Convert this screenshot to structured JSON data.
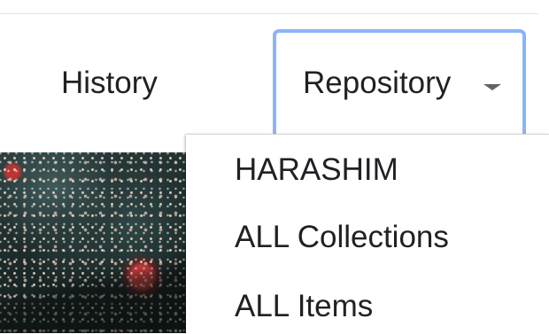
{
  "nav": {
    "history_label": "History",
    "repository_label": "Repository"
  },
  "dropdown": {
    "items": [
      {
        "label": "HARASHIM"
      },
      {
        "label": "ALL Collections"
      },
      {
        "label": "ALL Items"
      }
    ]
  },
  "icons": {
    "repository_caret": "caret-down-icon"
  },
  "colors": {
    "focus_outline": "#8ab4f8",
    "text": "#202124",
    "caret": "#5f6368"
  }
}
